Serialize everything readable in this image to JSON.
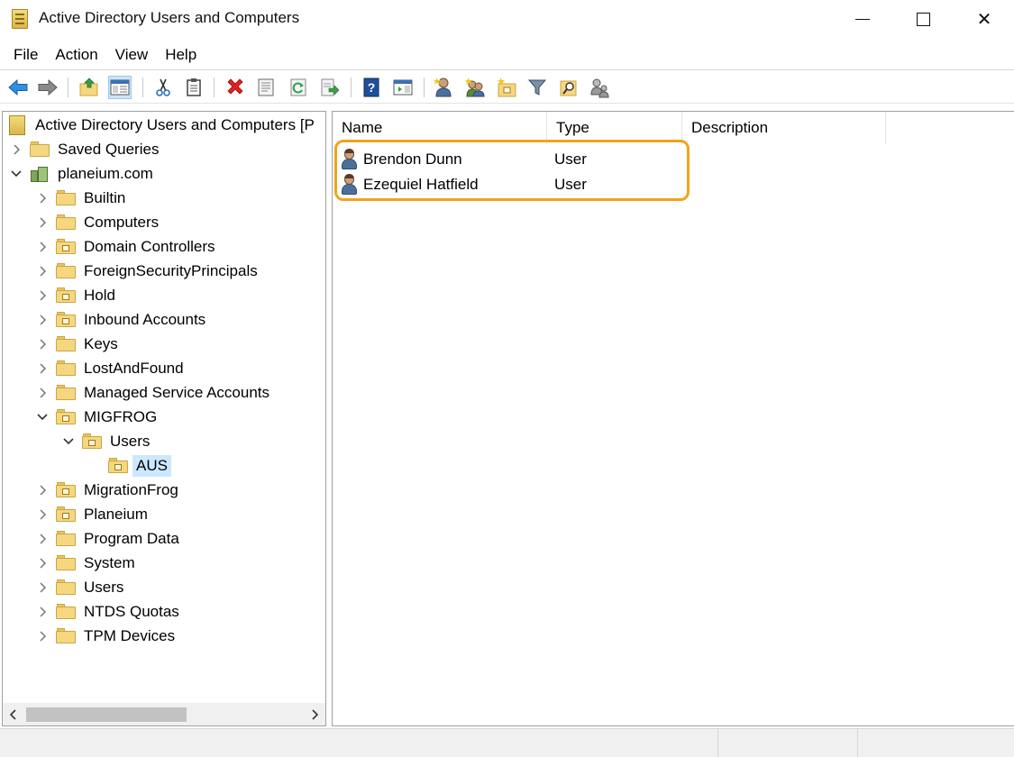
{
  "window": {
    "title": "Active Directory Users and Computers",
    "minimize_glyph": "—",
    "maximize_glyph": "☐",
    "close_glyph": "✕"
  },
  "menu": [
    "File",
    "Action",
    "View",
    "Help"
  ],
  "toolbar_icons": [
    "back-arrow-icon",
    "forward-arrow-icon",
    "up-folder-icon",
    "show-console-tree-icon",
    "cut-icon",
    "copy-icon",
    "delete-icon",
    "properties-icon",
    "refresh-icon",
    "export-list-icon",
    "help-icon",
    "show-action-pane-icon",
    "new-user-icon",
    "new-group-icon",
    "new-ou-icon",
    "filter-icon",
    "find-icon",
    "add-to-group-icon"
  ],
  "tree": {
    "root_label": "Active Directory Users and Computers [P",
    "items": [
      {
        "label": "Saved Queries",
        "level": 1,
        "expander": "collapsed",
        "icon": "folder"
      },
      {
        "label": "planeium.com",
        "level": 1,
        "expander": "expanded",
        "icon": "domain"
      },
      {
        "label": "Builtin",
        "level": 2,
        "expander": "collapsed",
        "icon": "folder"
      },
      {
        "label": "Computers",
        "level": 2,
        "expander": "collapsed",
        "icon": "folder"
      },
      {
        "label": "Domain Controllers",
        "level": 2,
        "expander": "collapsed",
        "icon": "ou"
      },
      {
        "label": "ForeignSecurityPrincipals",
        "level": 2,
        "expander": "collapsed",
        "icon": "folder"
      },
      {
        "label": "Hold",
        "level": 2,
        "expander": "collapsed",
        "icon": "ou"
      },
      {
        "label": "Inbound Accounts",
        "level": 2,
        "expander": "collapsed",
        "icon": "ou"
      },
      {
        "label": "Keys",
        "level": 2,
        "expander": "collapsed",
        "icon": "folder"
      },
      {
        "label": "LostAndFound",
        "level": 2,
        "expander": "collapsed",
        "icon": "folder"
      },
      {
        "label": "Managed Service Accounts",
        "level": 2,
        "expander": "collapsed",
        "icon": "folder"
      },
      {
        "label": "MIGFROG",
        "level": 2,
        "expander": "expanded",
        "icon": "ou"
      },
      {
        "label": "Users",
        "level": 3,
        "expander": "expanded",
        "icon": "ou"
      },
      {
        "label": "AUS",
        "level": 4,
        "expander": "none",
        "icon": "ou",
        "selected": true
      },
      {
        "label": "MigrationFrog",
        "level": 2,
        "expander": "collapsed",
        "icon": "ou"
      },
      {
        "label": "Planeium",
        "level": 2,
        "expander": "collapsed",
        "icon": "ou"
      },
      {
        "label": "Program Data",
        "level": 2,
        "expander": "collapsed",
        "icon": "folder"
      },
      {
        "label": "System",
        "level": 2,
        "expander": "collapsed",
        "icon": "folder"
      },
      {
        "label": "Users",
        "level": 2,
        "expander": "collapsed",
        "icon": "folder"
      },
      {
        "label": "NTDS Quotas",
        "level": 2,
        "expander": "collapsed",
        "icon": "folder"
      },
      {
        "label": "TPM Devices",
        "level": 2,
        "expander": "collapsed",
        "icon": "folder"
      }
    ]
  },
  "list": {
    "columns": [
      "Name",
      "Type",
      "Description"
    ],
    "rows": [
      {
        "name": "Brendon Dunn",
        "type": "User",
        "description": ""
      },
      {
        "name": "Ezequiel Hatfield",
        "type": "User",
        "description": ""
      }
    ]
  },
  "colors": {
    "highlight_border": "#f0a41a",
    "selection_bg": "#cce8ff"
  }
}
